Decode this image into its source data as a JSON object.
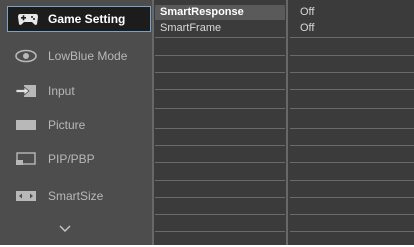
{
  "sidebar": {
    "items": [
      {
        "label": "Game Setting",
        "icon": "gamepad-icon",
        "active": true
      },
      {
        "label": "LowBlue Mode",
        "icon": "eye-icon",
        "active": false
      },
      {
        "label": "Input",
        "icon": "input-arrow-icon",
        "active": false
      },
      {
        "label": "Picture",
        "icon": "picture-icon",
        "active": false
      },
      {
        "label": "PIP/PBP",
        "icon": "pip-icon",
        "active": false
      },
      {
        "label": "SmartSize",
        "icon": "smartsize-icon",
        "active": false
      }
    ],
    "more_icon": "chevron-down-icon"
  },
  "submenu": {
    "items": [
      {
        "label": "SmartResponse",
        "value": "Off"
      },
      {
        "label": "SmartFrame",
        "value": "Off"
      }
    ]
  },
  "colors": {
    "background": "#3b3b3b",
    "sidebar": "#4d4d4d",
    "active_item": "#1c1c1c",
    "active_border": "#7aa3c8",
    "text": "#b8b8b8",
    "active_text": "#ffffff"
  }
}
